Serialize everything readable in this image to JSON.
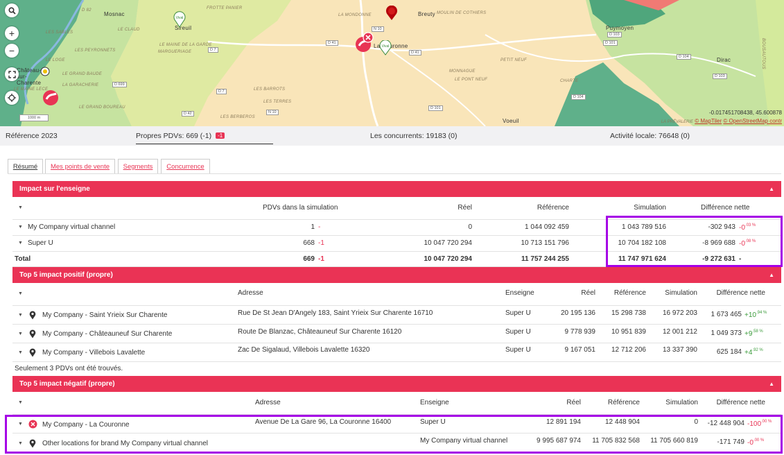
{
  "map": {
    "labels": [
      "D 82",
      "Mosnac",
      "FROTTE PANIER",
      "LA MONDONNE",
      "Breuty",
      "MOULIN DE COTHIERS",
      "Sireuil",
      "LES SABLES",
      "LE CLAUD",
      "LE MAINE DE LA GARDE",
      "LES PEYRONNETS",
      "LE LOGE",
      "MARGUERIAGE",
      "D 7",
      "N 10",
      "D 41",
      "La Couronne",
      "D 41",
      "D 103",
      "Puymoyen",
      "D 101",
      "D 104",
      "Dirac",
      "Château-sur-Charente",
      "LE GRAND BAUDE",
      "D 699",
      "LA GARACHERIE",
      "LE MAINE LECE",
      "LES BARROTS",
      "MONNAGUE",
      "LE PONT NEUF",
      "PETIT NEUF",
      "CHARTE",
      "D 7",
      "LES TERRES",
      "LES BERBEROS",
      "LE GRAND BOUREAU",
      "D 42",
      "N 10",
      "D 101",
      "Voeuil",
      "D 104",
      "D 103",
      "BOUSAUTOUS",
      "LA PRÉVALERIE"
    ],
    "scale": "1000 m",
    "coords": "-0.017451708438, 45.600878",
    "attribution_prefix": "LA PRÉVALERIE",
    "attribution_links": [
      "© MapTiler",
      "© OpenStreetMap contr"
    ],
    "controls": {
      "search": "search-icon",
      "zoom_in": "+",
      "zoom_out": "−",
      "fullscreen": "fullscreen-icon",
      "locate": "locate-icon"
    }
  },
  "kpis": {
    "reference": "Référence 2023",
    "own_pdvs": "Propres PDVs: 669 (-1)",
    "own_badge": "-1",
    "competitors": "Les concurrents: 19183 (0)",
    "local_activity": "Activité locale: 76648 (0)"
  },
  "tabs": [
    "Résumé",
    "Mes points de vente",
    "Segments",
    "Concurrence"
  ],
  "impact": {
    "title": "Impact sur l'enseigne",
    "headers": {
      "pdvs": "PDVs dans la simulation",
      "reel": "Réel",
      "reference": "Référence",
      "simulation": "Simulation",
      "diff": "Différence nette"
    },
    "rows": [
      {
        "name": "My Company virtual channel",
        "pdvs": "1",
        "pdvs_delta": "-",
        "reel": "0",
        "reference": "1 044 092 459",
        "simulation": "1 043 789 516",
        "diff": "-302 943",
        "pct": "-0",
        "pct_sup": ".03 %"
      },
      {
        "name": "Super U",
        "pdvs": "668",
        "pdvs_delta": "-1",
        "reel": "10 047 720 294",
        "reference": "10 713 151 796",
        "simulation": "10 704 182 108",
        "diff": "-8 969 688",
        "pct": "-0",
        "pct_sup": ".08 %"
      }
    ],
    "total": {
      "name": "Total",
      "pdvs": "669",
      "pdvs_delta": "-1",
      "reel": "10 047 720 294",
      "reference": "11 757 244 255",
      "simulation": "11 747 971 624",
      "diff": "-9 272 631",
      "pct": "-"
    }
  },
  "positive": {
    "title": "Top 5 impact positif (propre)",
    "headers": {
      "adresse": "Adresse",
      "enseigne": "Enseigne",
      "reel": "Réel",
      "reference": "Référence",
      "simulation": "Simulation",
      "diff": "Différence nette"
    },
    "rows": [
      {
        "name": "My Company - Saint Yrieix Sur Charente",
        "adresse": "Rue De St Jean D'Angely 183, Saint Yrieix Sur Charente 16710",
        "enseigne": "Super U",
        "reel": "20 195 136",
        "reference": "15 298 738",
        "simulation": "16 972 203",
        "diff": "1 673 465",
        "pct": "+10",
        "pct_sup": ".94 %"
      },
      {
        "name": "My Company - Châteauneuf Sur Charente",
        "adresse": "Route De Blanzac, Châteauneuf Sur Charente 16120",
        "enseigne": "Super U",
        "reel": "9 778 939",
        "reference": "10 951 839",
        "simulation": "12 001 212",
        "diff": "1 049 373",
        "pct": "+9",
        "pct_sup": ".58 %"
      },
      {
        "name": "My Company - Villebois Lavalette",
        "adresse": "Zac De Sigalaud, Villebois Lavalette 16320",
        "enseigne": "Super U",
        "reel": "9 167 051",
        "reference": "12 712 206",
        "simulation": "13 337 390",
        "diff": "625 184",
        "pct": "+4",
        "pct_sup": ".92 %"
      }
    ],
    "note": "Seulement 3 PDVs ont été trouvés."
  },
  "negative": {
    "title": "Top 5 impact négatif (propre)",
    "headers": {
      "adresse": "Adresse",
      "enseigne": "Enseigne",
      "reel": "Réel",
      "reference": "Référence",
      "simulation": "Simulation",
      "diff": "Différence nette"
    },
    "rows": [
      {
        "name": "My Company - La Couronne",
        "adresse": "Avenue De La Gare 96, La Couronne 16400",
        "enseigne": "Super U",
        "reel": "12 891 194",
        "reference": "12 448 904",
        "simulation": "0",
        "diff": "-12 448 904",
        "pct": "-100",
        "pct_sup": ".00 %"
      },
      {
        "name": "Other locations for brand My Company virtual channel",
        "adresse": "",
        "enseigne": "My Company virtual channel",
        "reel": "9 995 687 974",
        "reference": "11 705 832 568",
        "simulation": "11 705 660 819",
        "diff": "-171 749",
        "pct": "-0",
        "pct_sup": ".00 %"
      }
    ]
  },
  "colors": {
    "accent": "#ea3355",
    "highlight": "#a500e6",
    "positive": "#3b9b3b",
    "negative": "#e83454"
  }
}
